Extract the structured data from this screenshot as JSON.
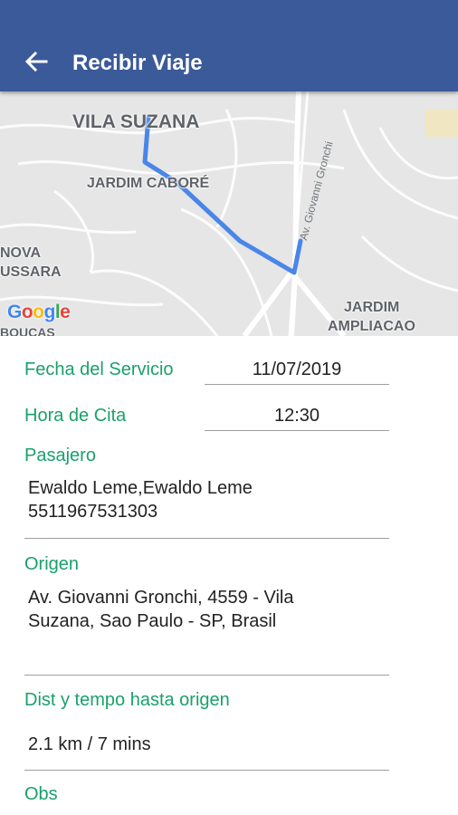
{
  "app_bar": {
    "title": "Recibir Viaje",
    "back_icon": "arrow-left-icon",
    "color": "#3b5a9a"
  },
  "map": {
    "labels": {
      "vila_suzana": "VILA SUZANA",
      "jardim_cabore": "JARDIM CABORÉ",
      "nova": "NOVA",
      "ussara": "USSARA",
      "jardim": "JARDIM",
      "ampliacao": "AMPLIACAO",
      "boucas": "BOUCAS",
      "street": "Av. Giovanni Gronchi"
    },
    "logo_letters": [
      "G",
      "o",
      "o",
      "g",
      "l",
      "e"
    ],
    "route_color": "#4a86e8"
  },
  "form": {
    "fecha_label": "Fecha del Servicio",
    "fecha_value": "11/07/2019",
    "hora_label": "Hora de Cita",
    "hora_value": "12:30",
    "pasajero_label": "Pasajero",
    "pasajero_name": "Ewaldo Leme,Ewaldo Leme",
    "pasajero_phone": "5511967531303",
    "origen_label": "Origen",
    "origen_line1": "Av. Giovanni Gronchi, 4559 - Vila",
    "origen_line2": "Suzana, Sao Paulo - SP, Brasil",
    "dist_label": "Dist y tempo hasta origen",
    "dist_value": "2.1 km / 7 mins",
    "obs_label": "Obs",
    "accent_color": "#1aa06b"
  }
}
